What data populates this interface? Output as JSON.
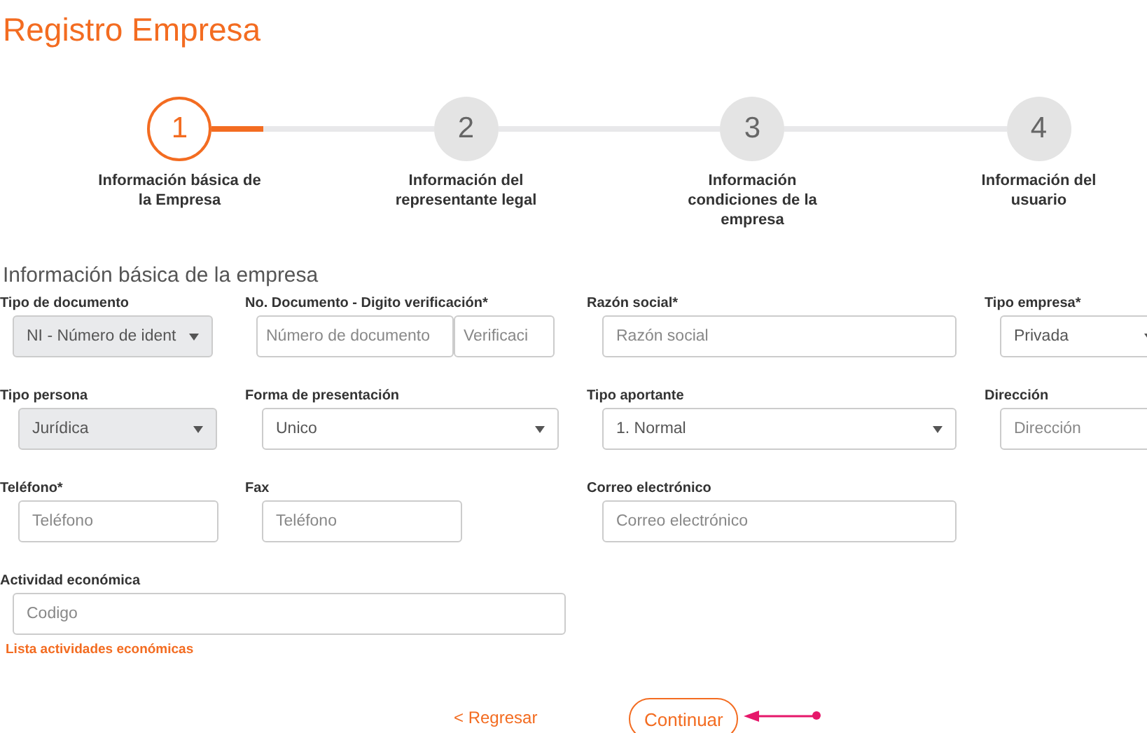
{
  "title": "Registro Empresa",
  "steps": [
    {
      "number": "1",
      "label": "Información básica de la Empresa",
      "selected": true
    },
    {
      "number": "2",
      "label": "Información del representante legal",
      "selected": false
    },
    {
      "number": "3",
      "label": "Información condiciones de la empresa",
      "selected": false
    },
    {
      "number": "4",
      "label": "Información del usuario",
      "selected": false
    }
  ],
  "section_title": "Información básica de la empresa",
  "rows": [
    [
      {
        "label": "Tipo de documento",
        "kind": "select",
        "value": "NI - Número de ident",
        "disabled": true
      },
      {
        "label": "No. Documento - Digito verificación*",
        "kind": "split",
        "placeholders": [
          "Número de documento",
          "Verificaci"
        ]
      },
      {
        "label": "Razón social*",
        "kind": "input",
        "placeholder": "Razón social"
      },
      {
        "label": "Tipo empresa*",
        "kind": "select",
        "value": "Privada",
        "disabled": false
      }
    ],
    [
      {
        "label": "Tipo persona",
        "kind": "select",
        "value": "Jurídica",
        "disabled": true
      },
      {
        "label": "Forma de presentación",
        "kind": "select",
        "value": "Unico",
        "disabled": false
      },
      {
        "label": "Tipo aportante",
        "kind": "select",
        "value": "1. Normal",
        "disabled": false
      },
      {
        "label": "Dirección",
        "kind": "input",
        "placeholder": "Dirección"
      }
    ],
    [
      {
        "label": "Teléfono*",
        "kind": "input",
        "placeholder": "Teléfono"
      },
      {
        "label": "Fax",
        "kind": "input",
        "placeholder": "Teléfono"
      },
      {
        "label": "Correo electrónico",
        "kind": "input",
        "placeholder": "Correo electrónico"
      }
    ],
    [
      {
        "label": "Actividad económica",
        "kind": "input",
        "placeholder": "Codigo",
        "link": "Lista actividades económicas"
      }
    ]
  ],
  "back_link": "< Regresar",
  "continue_button": "Continuar"
}
